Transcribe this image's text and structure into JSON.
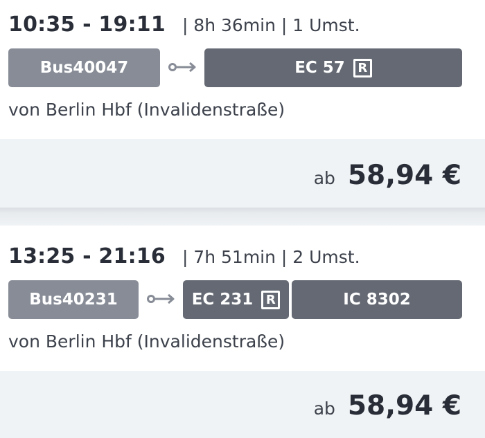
{
  "connections": [
    {
      "time_range": "10:35 - 19:11",
      "meta": "| 8h 36min | 1 Umst.",
      "legs": [
        {
          "label": "Bus40047",
          "kind": "bus"
        },
        {
          "label": "EC 57",
          "kind": "train",
          "badge": "R"
        }
      ],
      "origin": "von Berlin Hbf (Invalidenstraße)",
      "price_prefix": "ab",
      "price": "58,94 €"
    },
    {
      "time_range": "13:25 - 21:16",
      "meta": "| 7h 51min | 2 Umst.",
      "legs": [
        {
          "label": "Bus40231",
          "kind": "bus"
        },
        {
          "label": "EC 231",
          "kind": "train",
          "badge": "R"
        },
        {
          "label": "IC 8302",
          "kind": "train"
        }
      ],
      "origin": "von Berlin Hbf (Invalidenstraße)",
      "price_prefix": "ab",
      "price": "58,94 €"
    }
  ],
  "icons": {
    "walk_transfer": "walk-transfer-arrow-icon"
  },
  "colors": {
    "bus_chip": "#878c96",
    "train_chip": "#646973",
    "price_band": "#f0f3f5",
    "text_dark": "#282d37"
  }
}
